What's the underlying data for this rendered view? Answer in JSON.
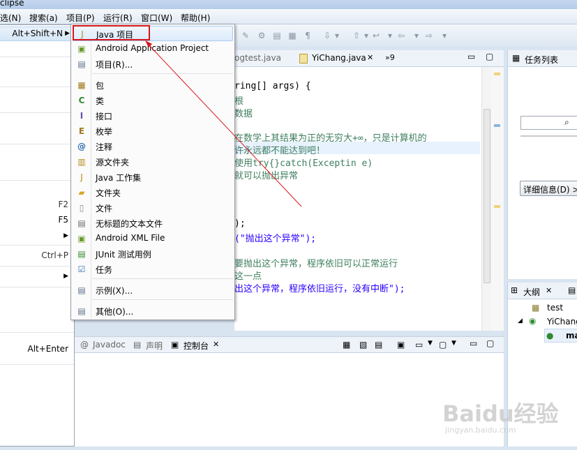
{
  "window": {
    "title": "clipse"
  },
  "menubar": {
    "items": [
      "选(N)",
      "搜索(a)",
      "项目(P)",
      "运行(R)",
      "窗口(W)",
      "帮助(H)"
    ]
  },
  "submenu": {
    "shortcuts": [
      "Alt+Shift+N",
      "F2",
      "F5",
      "Ctrl+P",
      "Alt+Enter"
    ]
  },
  "popup": {
    "items": [
      {
        "label": "Java 项目",
        "icon": "java-project-icon"
      },
      {
        "label": "Android Application Project",
        "icon": "android-project-icon"
      },
      {
        "label": "项目(R)...",
        "icon": "project-icon"
      },
      {
        "label": "包",
        "icon": "package-icon"
      },
      {
        "label": "类",
        "icon": "class-icon"
      },
      {
        "label": "接口",
        "icon": "interface-icon"
      },
      {
        "label": "枚举",
        "icon": "enum-icon"
      },
      {
        "label": "注释",
        "icon": "annotation-icon"
      },
      {
        "label": "源文件夹",
        "icon": "source-folder-icon"
      },
      {
        "label": "Java 工作集",
        "icon": "working-set-icon"
      },
      {
        "label": "文件夹",
        "icon": "folder-icon"
      },
      {
        "label": "文件",
        "icon": "file-icon"
      },
      {
        "label": "无标题的文本文件",
        "icon": "untitled-text-file-icon"
      },
      {
        "label": "Android XML File",
        "icon": "android-xml-icon"
      },
      {
        "label": "JUnit 测试用例",
        "icon": "junit-icon"
      },
      {
        "label": "任务",
        "icon": "task-icon"
      },
      {
        "label": "示例(X)...",
        "icon": "example-icon"
      },
      {
        "label": "其他(O)...",
        "icon": "other-icon"
      }
    ]
  },
  "editor": {
    "tabs": [
      {
        "label": "ogtest.java"
      },
      {
        "label": "YiChang.java"
      },
      {
        "label": "»9"
      }
    ],
    "lines": [
      {
        "text": "ring[] args) {",
        "kind": "code"
      },
      {
        "text": "根",
        "kind": "comment"
      },
      {
        "text": "数据",
        "kind": "comment"
      },
      {
        "text": "在数学上其结果为正的无穷大+∞，只是计算机的",
        "kind": "comment"
      },
      {
        "text": "许永远都不能达到吧！",
        "kind": "comment"
      },
      {
        "text": "使用try{}catch(Exceptin e)",
        "kind": "comment"
      },
      {
        "text": "就可以抛出异常",
        "kind": "comment"
      },
      {
        "text": ");",
        "kind": "code"
      },
      {
        "text": "(\"抛出这个异常\");",
        "kind": "string"
      },
      {
        "text": "要抛出这个异常，程序依旧可以正常运行",
        "kind": "comment"
      },
      {
        "text": "这一点",
        "kind": "comment"
      },
      {
        "text": "出这个异常，程序依旧运行，没有中断\");",
        "kind": "string"
      }
    ]
  },
  "bottom": {
    "tabs": [
      {
        "label": "Javadoc"
      },
      {
        "label": "声明"
      },
      {
        "label": "控制台"
      }
    ]
  },
  "task_panel": {
    "title": "任务列表",
    "details_label": "详细信息(D) >"
  },
  "outline_panel": {
    "title": "大纲",
    "items": [
      "test",
      "YiChang",
      "ma"
    ]
  },
  "watermark": {
    "brand": "Baidu经验",
    "domain": "jingyan.baidu.com"
  },
  "colors": {
    "highlight_box": "#d8141c",
    "comment": "#3f7f5f",
    "string": "#2a00ff"
  }
}
